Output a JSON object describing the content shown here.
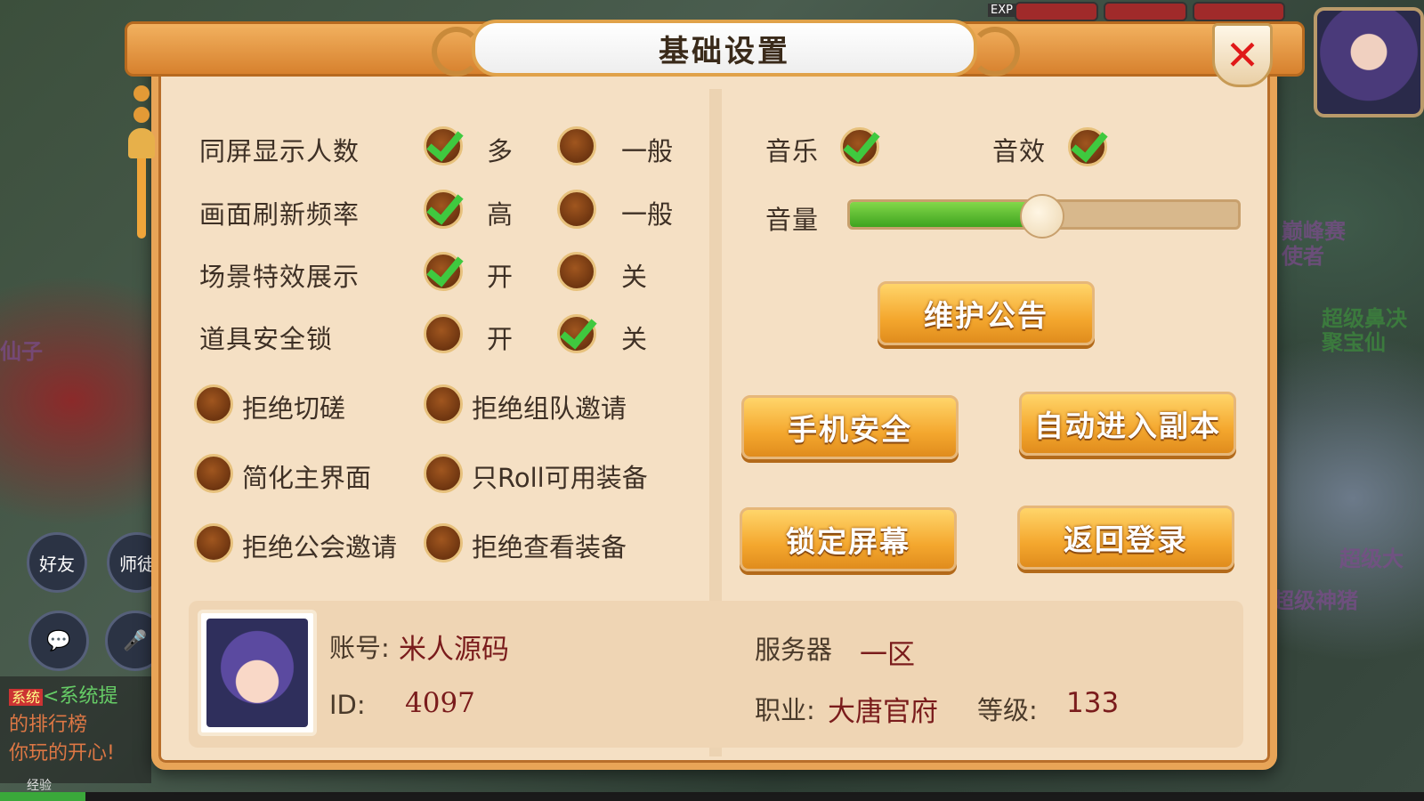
{
  "dialog": {
    "title": "基础设置",
    "close_symbol": "✕",
    "close_icon": "close-icon"
  },
  "display_settings": [
    {
      "label": "同屏显示人数",
      "options": [
        {
          "text": "多",
          "checked": true
        },
        {
          "text": "一般",
          "checked": false
        }
      ]
    },
    {
      "label": "画面刷新频率",
      "options": [
        {
          "text": "高",
          "checked": true
        },
        {
          "text": "一般",
          "checked": false
        }
      ]
    },
    {
      "label": "场景特效展示",
      "options": [
        {
          "text": "开",
          "checked": true
        },
        {
          "text": "关",
          "checked": false
        }
      ]
    },
    {
      "label": "道具安全锁",
      "options": [
        {
          "text": "开",
          "checked": false
        },
        {
          "text": "关",
          "checked": true
        }
      ]
    }
  ],
  "toggles": [
    {
      "text": "拒绝切磋",
      "checked": false
    },
    {
      "text": "拒绝组队邀请",
      "checked": false
    },
    {
      "text": "简化主界面",
      "checked": false
    },
    {
      "text": "只Roll可用装备",
      "checked": false
    },
    {
      "text": "拒绝公会邀请",
      "checked": false
    },
    {
      "text": "拒绝查看装备",
      "checked": false
    }
  ],
  "audio": {
    "music_label": "音乐",
    "music_on": true,
    "sfx_label": "音效",
    "sfx_on": true,
    "volume_label": "音量",
    "volume_fraction": 0.49
  },
  "buttons": {
    "maintenance": "维护公告",
    "phone_security": "手机安全",
    "auto_dungeon": "自动进入副本",
    "lock_screen": "锁定屏幕",
    "return_login": "返回登录"
  },
  "account": {
    "account_label": "账号:",
    "account_name": "米人源码",
    "id_label": "ID:",
    "id_value": "4097",
    "server_label": "服务器",
    "server_value": "一区",
    "class_label": "职业:",
    "class_value": "大唐官府",
    "level_label": "等级:",
    "level_value": "133"
  },
  "background": {
    "friends_label": "好友",
    "mentor_label": "师徒",
    "chat_tag": "系统",
    "chat_line1": "<系统提",
    "chat_line2": "的排行榜",
    "chat_line3": "你玩的开心!",
    "left_text": "仙子",
    "right_text1": "巅峰赛",
    "right_text2": "使者",
    "right_text3": "超级鼻决",
    "right_text4": "聚宝仙",
    "right_text5": "超级大",
    "right_text6": "超级神猪",
    "exp_label": "经验",
    "exp_fraction": 0.06,
    "top_tag": "EXP"
  }
}
